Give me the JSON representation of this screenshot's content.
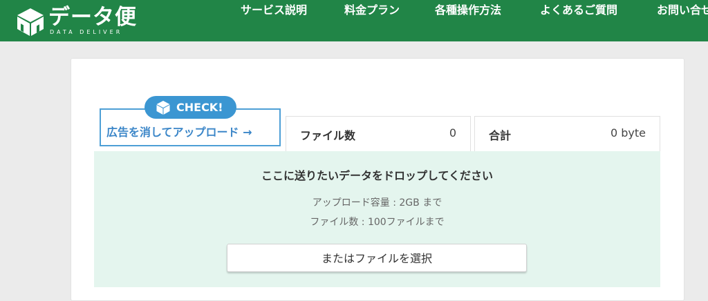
{
  "brand": {
    "title": "データ便",
    "subtitle": "DATA DELIVER",
    "logo_icon": "cube-icon"
  },
  "nav": [
    {
      "label": "サービス説明"
    },
    {
      "label": "料金プラン"
    },
    {
      "label": "各種操作方法"
    },
    {
      "label": "よくあるご質問"
    },
    {
      "label": "お問い合せ"
    }
  ],
  "promo": {
    "badge": "CHECK!",
    "text": "広告を消してアップロード →",
    "color": "#3b96d2"
  },
  "stats": {
    "files_label": "ファイル数",
    "files_value": "0",
    "total_label": "合計",
    "total_value": "0 byte"
  },
  "dropzone": {
    "title": "ここに送りたいデータをドロップしてください",
    "limit_size": "アップロード容量 : 2GB まで",
    "limit_count": "ファイル数 : 100ファイルまで",
    "button_label": "またはファイルを選択",
    "background": "#e4f5ee"
  },
  "colors": {
    "header": "#218547",
    "page": "#ebebeb"
  }
}
